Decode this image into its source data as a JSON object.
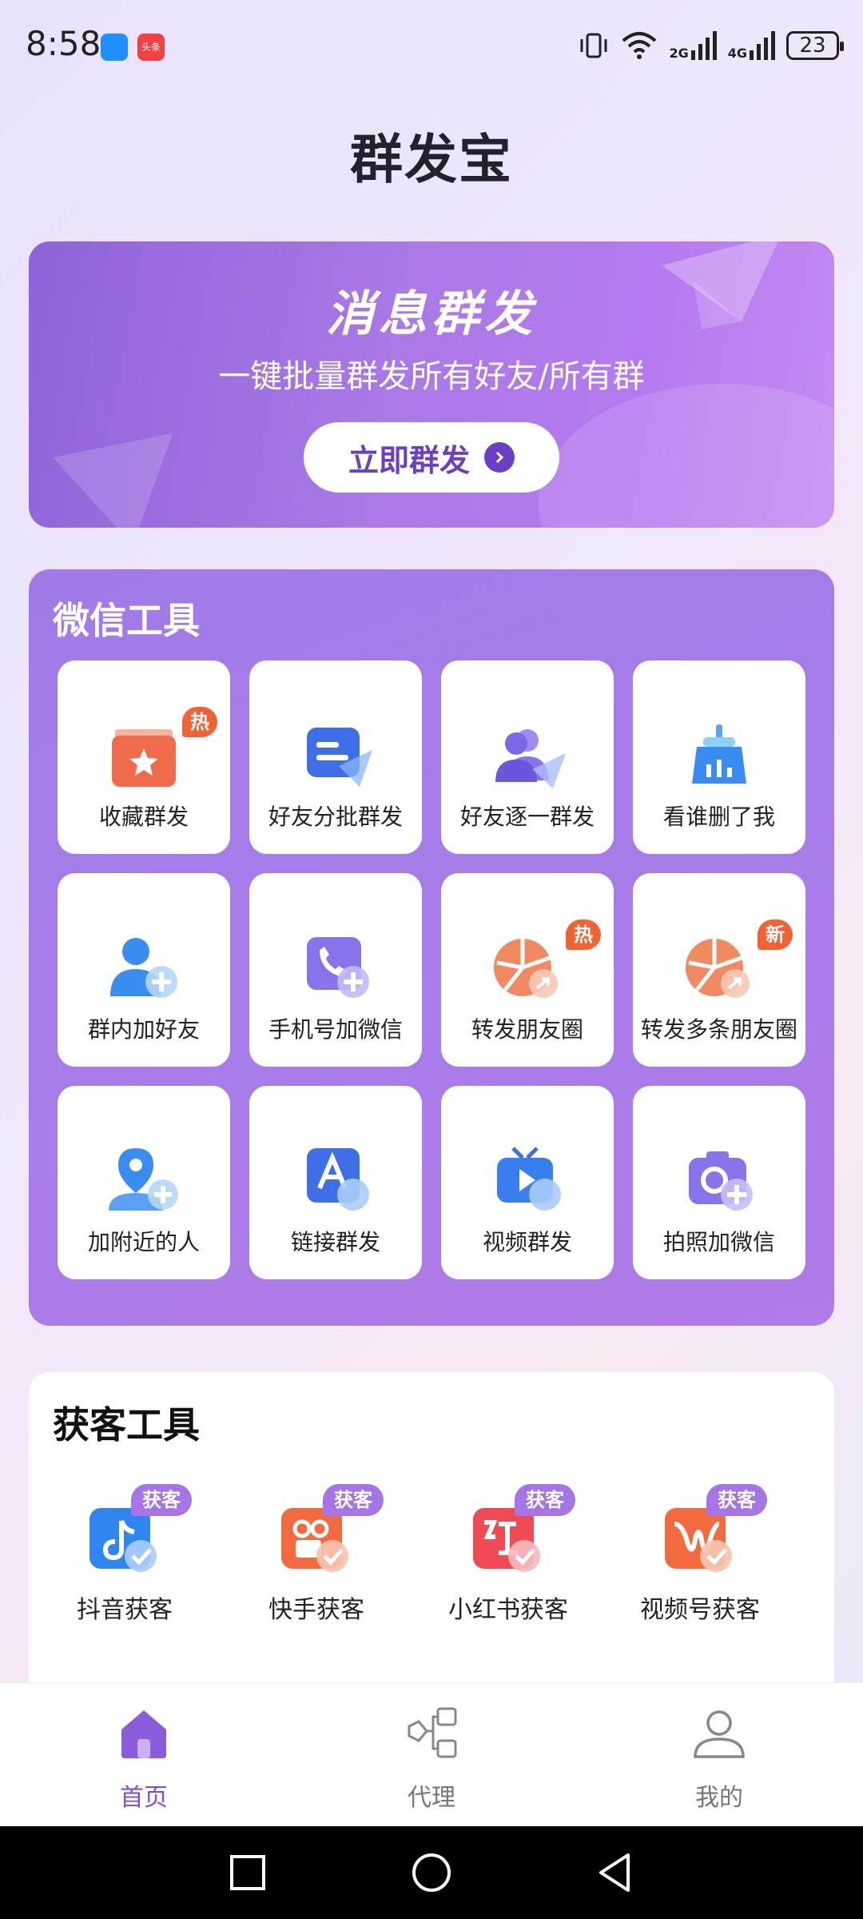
{
  "status_bar": {
    "time": "8:58",
    "battery": "23",
    "network_2g": "2G",
    "network_4g": "4G",
    "toutiao_label": "头条"
  },
  "page": {
    "title": "群发宝"
  },
  "banner": {
    "title": "消息群发",
    "subtitle": "一键批量群发所有好友/所有群",
    "button": "立即群发"
  },
  "wechat_tools": {
    "title": "微信工具",
    "items": [
      {
        "label": "收藏群发",
        "badge": "热",
        "icon": "favorite-folder-icon"
      },
      {
        "label": "好友分批群发",
        "icon": "batch-send-icon"
      },
      {
        "label": "好友逐一群发",
        "icon": "friends-send-icon"
      },
      {
        "label": "看谁删了我",
        "icon": "sweep-check-icon"
      },
      {
        "label": "群内加好友",
        "icon": "add-friend-icon"
      },
      {
        "label": "手机号加微信",
        "icon": "phone-add-icon"
      },
      {
        "label": "转发朋友圈",
        "badge": "热",
        "icon": "moments-forward-icon"
      },
      {
        "label": "转发多条朋友圈",
        "badge": "新",
        "icon": "moments-multi-forward-icon"
      },
      {
        "label": "加附近的人",
        "icon": "nearby-people-icon"
      },
      {
        "label": "链接群发",
        "icon": "link-send-icon"
      },
      {
        "label": "视频群发",
        "icon": "video-send-icon"
      },
      {
        "label": "拍照加微信",
        "icon": "camera-add-icon"
      }
    ]
  },
  "customer_tools": {
    "title": "获客工具",
    "items": [
      {
        "label": "抖音获客",
        "badge": "获客",
        "icon": "douyin-icon"
      },
      {
        "label": "快手获客",
        "badge": "获客",
        "icon": "kuaishou-icon"
      },
      {
        "label": "小红书获客",
        "badge": "获客",
        "icon": "xiaohongshu-icon"
      },
      {
        "label": "视频号获客",
        "badge": "获客",
        "icon": "channels-icon"
      }
    ]
  },
  "bottom_nav": {
    "items": [
      {
        "label": "首页",
        "active": true,
        "icon": "home-icon"
      },
      {
        "label": "代理",
        "active": false,
        "icon": "network-icon"
      },
      {
        "label": "我的",
        "active": false,
        "icon": "user-icon"
      }
    ]
  },
  "colors": {
    "accent": "#7d4fd6",
    "panel": "#a67be8",
    "hot_badge": "#f26232",
    "customer_badge": "#a574e6"
  }
}
